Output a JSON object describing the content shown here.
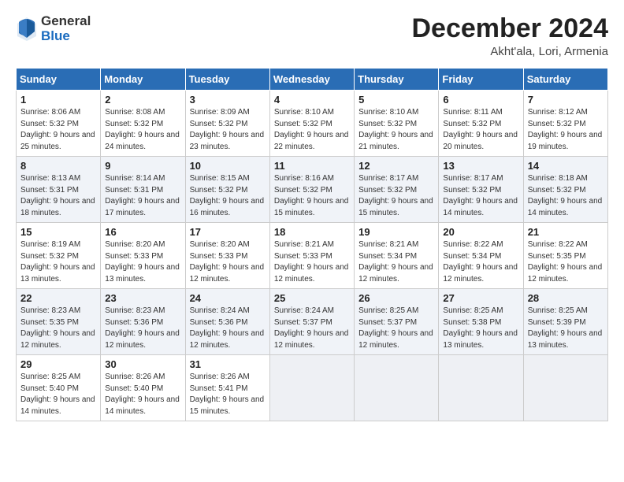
{
  "header": {
    "logo_general": "General",
    "logo_blue": "Blue",
    "month_title": "December 2024",
    "subtitle": "Akht'ala, Lori, Armenia"
  },
  "days_of_week": [
    "Sunday",
    "Monday",
    "Tuesday",
    "Wednesday",
    "Thursday",
    "Friday",
    "Saturday"
  ],
  "weeks": [
    [
      {
        "day": "1",
        "sunrise": "Sunrise: 8:06 AM",
        "sunset": "Sunset: 5:32 PM",
        "daylight": "Daylight: 9 hours and 25 minutes."
      },
      {
        "day": "2",
        "sunrise": "Sunrise: 8:08 AM",
        "sunset": "Sunset: 5:32 PM",
        "daylight": "Daylight: 9 hours and 24 minutes."
      },
      {
        "day": "3",
        "sunrise": "Sunrise: 8:09 AM",
        "sunset": "Sunset: 5:32 PM",
        "daylight": "Daylight: 9 hours and 23 minutes."
      },
      {
        "day": "4",
        "sunrise": "Sunrise: 8:10 AM",
        "sunset": "Sunset: 5:32 PM",
        "daylight": "Daylight: 9 hours and 22 minutes."
      },
      {
        "day": "5",
        "sunrise": "Sunrise: 8:10 AM",
        "sunset": "Sunset: 5:32 PM",
        "daylight": "Daylight: 9 hours and 21 minutes."
      },
      {
        "day": "6",
        "sunrise": "Sunrise: 8:11 AM",
        "sunset": "Sunset: 5:32 PM",
        "daylight": "Daylight: 9 hours and 20 minutes."
      },
      {
        "day": "7",
        "sunrise": "Sunrise: 8:12 AM",
        "sunset": "Sunset: 5:32 PM",
        "daylight": "Daylight: 9 hours and 19 minutes."
      }
    ],
    [
      {
        "day": "8",
        "sunrise": "Sunrise: 8:13 AM",
        "sunset": "Sunset: 5:31 PM",
        "daylight": "Daylight: 9 hours and 18 minutes."
      },
      {
        "day": "9",
        "sunrise": "Sunrise: 8:14 AM",
        "sunset": "Sunset: 5:31 PM",
        "daylight": "Daylight: 9 hours and 17 minutes."
      },
      {
        "day": "10",
        "sunrise": "Sunrise: 8:15 AM",
        "sunset": "Sunset: 5:32 PM",
        "daylight": "Daylight: 9 hours and 16 minutes."
      },
      {
        "day": "11",
        "sunrise": "Sunrise: 8:16 AM",
        "sunset": "Sunset: 5:32 PM",
        "daylight": "Daylight: 9 hours and 15 minutes."
      },
      {
        "day": "12",
        "sunrise": "Sunrise: 8:17 AM",
        "sunset": "Sunset: 5:32 PM",
        "daylight": "Daylight: 9 hours and 15 minutes."
      },
      {
        "day": "13",
        "sunrise": "Sunrise: 8:17 AM",
        "sunset": "Sunset: 5:32 PM",
        "daylight": "Daylight: 9 hours and 14 minutes."
      },
      {
        "day": "14",
        "sunrise": "Sunrise: 8:18 AM",
        "sunset": "Sunset: 5:32 PM",
        "daylight": "Daylight: 9 hours and 14 minutes."
      }
    ],
    [
      {
        "day": "15",
        "sunrise": "Sunrise: 8:19 AM",
        "sunset": "Sunset: 5:32 PM",
        "daylight": "Daylight: 9 hours and 13 minutes."
      },
      {
        "day": "16",
        "sunrise": "Sunrise: 8:20 AM",
        "sunset": "Sunset: 5:33 PM",
        "daylight": "Daylight: 9 hours and 13 minutes."
      },
      {
        "day": "17",
        "sunrise": "Sunrise: 8:20 AM",
        "sunset": "Sunset: 5:33 PM",
        "daylight": "Daylight: 9 hours and 12 minutes."
      },
      {
        "day": "18",
        "sunrise": "Sunrise: 8:21 AM",
        "sunset": "Sunset: 5:33 PM",
        "daylight": "Daylight: 9 hours and 12 minutes."
      },
      {
        "day": "19",
        "sunrise": "Sunrise: 8:21 AM",
        "sunset": "Sunset: 5:34 PM",
        "daylight": "Daylight: 9 hours and 12 minutes."
      },
      {
        "day": "20",
        "sunrise": "Sunrise: 8:22 AM",
        "sunset": "Sunset: 5:34 PM",
        "daylight": "Daylight: 9 hours and 12 minutes."
      },
      {
        "day": "21",
        "sunrise": "Sunrise: 8:22 AM",
        "sunset": "Sunset: 5:35 PM",
        "daylight": "Daylight: 9 hours and 12 minutes."
      }
    ],
    [
      {
        "day": "22",
        "sunrise": "Sunrise: 8:23 AM",
        "sunset": "Sunset: 5:35 PM",
        "daylight": "Daylight: 9 hours and 12 minutes."
      },
      {
        "day": "23",
        "sunrise": "Sunrise: 8:23 AM",
        "sunset": "Sunset: 5:36 PM",
        "daylight": "Daylight: 9 hours and 12 minutes."
      },
      {
        "day": "24",
        "sunrise": "Sunrise: 8:24 AM",
        "sunset": "Sunset: 5:36 PM",
        "daylight": "Daylight: 9 hours and 12 minutes."
      },
      {
        "day": "25",
        "sunrise": "Sunrise: 8:24 AM",
        "sunset": "Sunset: 5:37 PM",
        "daylight": "Daylight: 9 hours and 12 minutes."
      },
      {
        "day": "26",
        "sunrise": "Sunrise: 8:25 AM",
        "sunset": "Sunset: 5:37 PM",
        "daylight": "Daylight: 9 hours and 12 minutes."
      },
      {
        "day": "27",
        "sunrise": "Sunrise: 8:25 AM",
        "sunset": "Sunset: 5:38 PM",
        "daylight": "Daylight: 9 hours and 13 minutes."
      },
      {
        "day": "28",
        "sunrise": "Sunrise: 8:25 AM",
        "sunset": "Sunset: 5:39 PM",
        "daylight": "Daylight: 9 hours and 13 minutes."
      }
    ],
    [
      {
        "day": "29",
        "sunrise": "Sunrise: 8:25 AM",
        "sunset": "Sunset: 5:40 PM",
        "daylight": "Daylight: 9 hours and 14 minutes."
      },
      {
        "day": "30",
        "sunrise": "Sunrise: 8:26 AM",
        "sunset": "Sunset: 5:40 PM",
        "daylight": "Daylight: 9 hours and 14 minutes."
      },
      {
        "day": "31",
        "sunrise": "Sunrise: 8:26 AM",
        "sunset": "Sunset: 5:41 PM",
        "daylight": "Daylight: 9 hours and 15 minutes."
      },
      null,
      null,
      null,
      null
    ]
  ]
}
